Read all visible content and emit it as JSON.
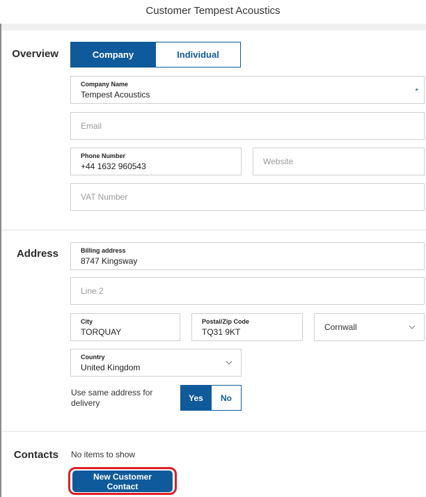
{
  "window": {
    "title": "Customer Tempest Acoustics"
  },
  "overview": {
    "section_label": "Overview",
    "type_tabs": [
      {
        "label": "Company",
        "active": true
      },
      {
        "label": "Individual",
        "active": false
      }
    ],
    "company_name": {
      "label": "Company Name",
      "value": "Tempest Acoustics",
      "required_mark": "*"
    },
    "email": {
      "placeholder": "Email"
    },
    "phone": {
      "label": "Phone Number",
      "value": "+44 1632 960543"
    },
    "website": {
      "placeholder": "Website"
    },
    "vat": {
      "placeholder": "VAT Number"
    }
  },
  "address": {
    "section_label": "Address",
    "billing": {
      "label": "Billing address",
      "value": "8747 Kingsway"
    },
    "line2": {
      "placeholder": "Line 2"
    },
    "city": {
      "label": "City",
      "value": "TORQUAY"
    },
    "postal": {
      "label": "Postal/Zip Code",
      "value": "TQ31 9KT"
    },
    "county": {
      "value": "Cornwall"
    },
    "country": {
      "label": "Country",
      "value": "United Kingdom"
    },
    "same_delivery": {
      "question_line1": "Use same address for",
      "question_line2": "delivery",
      "yes_label": "Yes",
      "no_label": "No",
      "selected": "Yes"
    }
  },
  "contacts": {
    "section_label": "Contacts",
    "empty_text": "No items to show",
    "new_button_label": "New Customer Contact"
  },
  "colors": {
    "accent": "#0f5a9a",
    "highlight": "#e01e26"
  }
}
